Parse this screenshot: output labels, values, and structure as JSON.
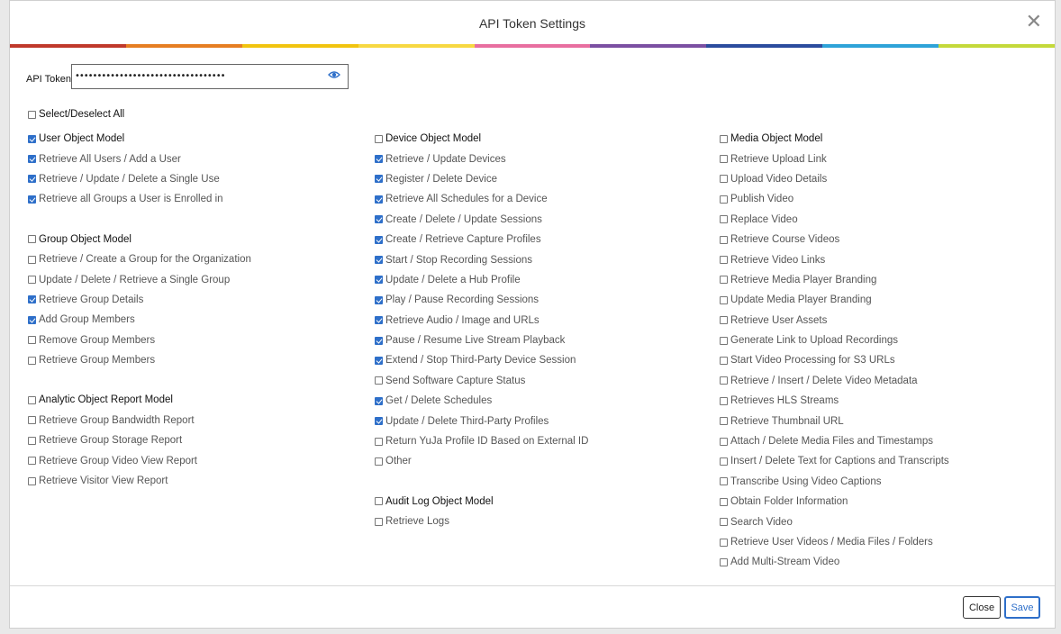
{
  "dialog": {
    "title": "API Token Settings",
    "close_icon": "close-icon",
    "rainbow_colors": [
      "#c0392b",
      "#e67e22",
      "#f1c40f",
      "#f7d842",
      "#e86ea0",
      "#7b4fa2",
      "#2b4c9e",
      "#2ea3d8",
      "#c4d93a"
    ]
  },
  "token": {
    "label": "API Token",
    "value": "••••••••••••••••••••••••••••••••••",
    "reveal_icon": "eye-icon"
  },
  "select_all": {
    "label": "Select/Deselect All",
    "checked": false
  },
  "columns": [
    {
      "groups": [
        {
          "title": "User Object Model",
          "checked": true,
          "items": [
            {
              "label": "Retrieve All Users / Add a User",
              "checked": true
            },
            {
              "label": "Retrieve / Update / Delete a Single Use",
              "checked": true
            },
            {
              "label": "Retrieve all Groups a User is Enrolled in",
              "checked": true
            }
          ]
        },
        {
          "title": "Group Object Model",
          "checked": false,
          "items": [
            {
              "label": "Retrieve / Create a Group for the Organization",
              "checked": false
            },
            {
              "label": "Update / Delete / Retrieve a Single Group",
              "checked": false
            },
            {
              "label": "Retrieve Group Details",
              "checked": true
            },
            {
              "label": "Add Group Members",
              "checked": true
            },
            {
              "label": "Remove Group Members",
              "checked": false
            },
            {
              "label": "Retrieve Group Members",
              "checked": false
            }
          ]
        },
        {
          "title": "Analytic Object Report Model",
          "checked": false,
          "items": [
            {
              "label": "Retrieve Group Bandwidth Report",
              "checked": false
            },
            {
              "label": "Retrieve Group Storage Report",
              "checked": false
            },
            {
              "label": "Retrieve Group Video View Report",
              "checked": false
            },
            {
              "label": "Retrieve Visitor View Report",
              "checked": false
            }
          ]
        }
      ]
    },
    {
      "groups": [
        {
          "title": "Device Object Model",
          "checked": false,
          "items": [
            {
              "label": "Retrieve / Update Devices",
              "checked": true
            },
            {
              "label": "Register / Delete Device",
              "checked": true
            },
            {
              "label": "Retrieve All Schedules for a Device",
              "checked": true
            },
            {
              "label": "Create / Delete / Update Sessions",
              "checked": true
            },
            {
              "label": "Create / Retrieve Capture Profiles",
              "checked": true
            },
            {
              "label": "Start / Stop Recording Sessions",
              "checked": true
            },
            {
              "label": "Update / Delete a Hub Profile",
              "checked": true
            },
            {
              "label": "Play / Pause Recording Sessions",
              "checked": true
            },
            {
              "label": "Retrieve Audio / Image and URLs",
              "checked": true
            },
            {
              "label": "Pause / Resume Live Stream Playback",
              "checked": true
            },
            {
              "label": "Extend / Stop Third-Party Device Session",
              "checked": true
            },
            {
              "label": "Send Software Capture Status",
              "checked": false
            },
            {
              "label": "Get / Delete Schedules",
              "checked": true
            },
            {
              "label": "Update / Delete Third-Party Profiles",
              "checked": true
            },
            {
              "label": "Return YuJa Profile ID Based on External ID",
              "checked": false
            },
            {
              "label": "Other",
              "checked": false
            }
          ]
        },
        {
          "title": "Audit Log Object Model",
          "checked": false,
          "items": [
            {
              "label": "Retrieve Logs",
              "checked": false
            }
          ]
        }
      ]
    },
    {
      "groups": [
        {
          "title": "Media Object Model",
          "checked": false,
          "items": [
            {
              "label": "Retrieve Upload Link",
              "checked": false
            },
            {
              "label": "Upload Video Details",
              "checked": false
            },
            {
              "label": "Publish Video",
              "checked": false
            },
            {
              "label": "Replace Video",
              "checked": false
            },
            {
              "label": "Retrieve Course Videos",
              "checked": false
            },
            {
              "label": "Retrieve Video Links",
              "checked": false
            },
            {
              "label": "Retrieve Media Player Branding",
              "checked": false
            },
            {
              "label": "Update Media Player Branding",
              "checked": false
            },
            {
              "label": "Retrieve User Assets",
              "checked": false
            },
            {
              "label": "Generate Link to Upload Recordings",
              "checked": false
            },
            {
              "label": "Start Video Processing for S3 URLs",
              "checked": false
            },
            {
              "label": "Retrieve / Insert / Delete Video Metadata",
              "checked": false
            },
            {
              "label": "Retrieves HLS Streams",
              "checked": false
            },
            {
              "label": "Retrieve Thumbnail URL",
              "checked": false
            },
            {
              "label": "Attach / Delete Media Files and Timestamps",
              "checked": false
            },
            {
              "label": "Insert / Delete Text for Captions and Transcripts",
              "checked": false
            },
            {
              "label": "Transcribe Using Video Captions",
              "checked": false
            },
            {
              "label": "Obtain Folder Information",
              "checked": false
            },
            {
              "label": "Search Video",
              "checked": false
            },
            {
              "label": "Retrieve User Videos / Media Files / Folders",
              "checked": false
            },
            {
              "label": "Add Multi-Stream Video",
              "checked": false
            }
          ]
        }
      ]
    }
  ],
  "footer": {
    "close_label": "Close",
    "save_label": "Save"
  },
  "colors": {
    "accent": "#2e6fc9"
  }
}
